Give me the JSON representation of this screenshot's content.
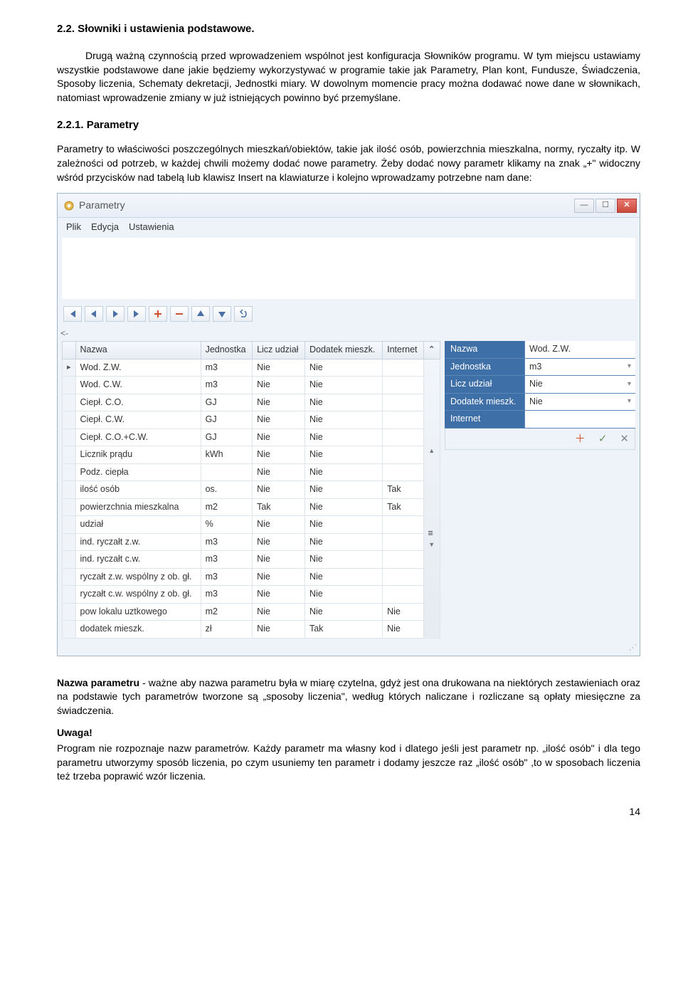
{
  "section_title": "2.2. Słowniki i ustawienia podstawowe.",
  "intro": "Drugą ważną czynnością przed wprowadzeniem wspólnot jest konfiguracja Słowników programu. W tym miejscu ustawiamy wszystkie podstawowe dane jakie będziemy wykorzystywać w programie takie jak Parametry, Plan kont, Fundusze, Świadczenia, Sposoby liczenia, Schematy dekretacji, Jednostki miary. W dowolnym momencie pracy można dodawać nowe dane w słownikach, natomiast wprowadzenie zmiany w już istniejących powinno być przemyślane.",
  "subsection_title": "2.2.1. Parametry",
  "para2": "Parametry to właściwości poszczególnych mieszkań/obiektów, takie jak ilość osób, powierzchnia mieszkalna, normy, ryczałty itp. W zależności od potrzeb, w każdej chwili możemy dodać nowe parametry. Żeby dodać nowy parametr klikamy na znak „+\" widoczny wśród przycisków nad tabelą lub klawisz Insert na klawiaturze i kolejno wprowadzamy potrzebne nam dane:",
  "window": {
    "title": "Parametry",
    "menu": [
      "Plik",
      "Edycja",
      "Ustawienia"
    ],
    "hint_back": "<-",
    "columns": [
      "Nazwa",
      "Jednostka",
      "Licz udział",
      "Dodatek mieszk.",
      "Internet"
    ],
    "rows": [
      {
        "n": "Wod. Z.W.",
        "j": "m3",
        "l": "Nie",
        "d": "Nie",
        "i": ""
      },
      {
        "n": "Wod. C.W.",
        "j": "m3",
        "l": "Nie",
        "d": "Nie",
        "i": ""
      },
      {
        "n": "Ciepł. C.O.",
        "j": "GJ",
        "l": "Nie",
        "d": "Nie",
        "i": ""
      },
      {
        "n": "Ciepł. C.W.",
        "j": "GJ",
        "l": "Nie",
        "d": "Nie",
        "i": ""
      },
      {
        "n": "Ciepł. C.O.+C.W.",
        "j": "GJ",
        "l": "Nie",
        "d": "Nie",
        "i": ""
      },
      {
        "n": "Licznik prądu",
        "j": "kWh",
        "l": "Nie",
        "d": "Nie",
        "i": ""
      },
      {
        "n": "Podz. ciepła",
        "j": "",
        "l": "Nie",
        "d": "Nie",
        "i": ""
      },
      {
        "n": "ilość osób",
        "j": "os.",
        "l": "Nie",
        "d": "Nie",
        "i": "Tak"
      },
      {
        "n": "powierzchnia mieszkalna",
        "j": "m2",
        "l": "Tak",
        "d": "Nie",
        "i": "Tak"
      },
      {
        "n": "udział",
        "j": "%",
        "l": "Nie",
        "d": "Nie",
        "i": ""
      },
      {
        "n": "ind. ryczałt z.w.",
        "j": "m3",
        "l": "Nie",
        "d": "Nie",
        "i": ""
      },
      {
        "n": "ind. ryczałt c.w.",
        "j": "m3",
        "l": "Nie",
        "d": "Nie",
        "i": ""
      },
      {
        "n": "ryczałt z.w. wspólny z ob. gł.",
        "j": "m3",
        "l": "Nie",
        "d": "Nie",
        "i": ""
      },
      {
        "n": "ryczałt c.w. wspólny z ob. gł.",
        "j": "m3",
        "l": "Nie",
        "d": "Nie",
        "i": ""
      },
      {
        "n": "pow lokalu uztkowego",
        "j": "m2",
        "l": "Nie",
        "d": "Nie",
        "i": "Nie"
      },
      {
        "n": "dodatek mieszk.",
        "j": "zł",
        "l": "Nie",
        "d": "Tak",
        "i": "Nie"
      }
    ],
    "form": {
      "fields": [
        {
          "label": "Nazwa",
          "value": "Wod. Z.W.",
          "dd": false
        },
        {
          "label": "Jednostka",
          "value": "m3",
          "dd": true
        },
        {
          "label": "Licz udział",
          "value": "Nie",
          "dd": true
        },
        {
          "label": "Dodatek mieszk.",
          "value": "Nie",
          "dd": true
        },
        {
          "label": "Internet",
          "value": "",
          "dd": false
        }
      ],
      "btn_add": "＋",
      "btn_ok": "✓",
      "btn_cancel": "✕"
    },
    "scroll_topglyph": "⌃",
    "scroll_eqglyph": "≡"
  },
  "after1_label": "Nazwa parametru",
  "after1_rest": " - ważne aby nazwa parametru była w miarę czytelna, gdyż jest ona drukowana na niektórych zestawieniach oraz na podstawie tych parametrów tworzone są „sposoby liczenia\", według których naliczane i rozliczane są opłaty miesięczne za świadczenia.",
  "uwaga": "Uwaga!",
  "after2": "Program nie rozpoznaje nazw parametrów. Każdy parametr ma własny kod i dlatego jeśli jest parametr np. „ilość osób\" i dla tego parametru utworzymy sposób liczenia, po czym usuniemy ten parametr i dodamy jeszcze raz „ilość osób\" ,to w sposobach liczenia też trzeba poprawić wzór liczenia.",
  "page": "14"
}
